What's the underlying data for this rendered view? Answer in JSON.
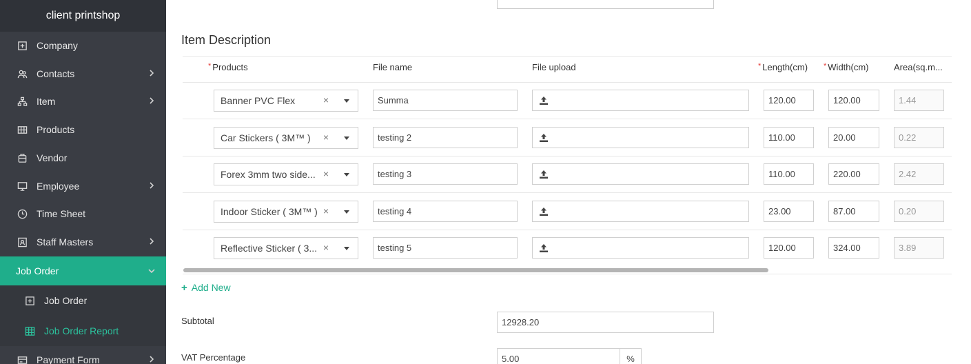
{
  "sidebar": {
    "brand": "client printshop",
    "items": [
      {
        "label": "Company",
        "icon": "plus-square-icon",
        "chevron": false
      },
      {
        "label": "Contacts",
        "icon": "users-icon",
        "chevron": true
      },
      {
        "label": "Item",
        "icon": "sitemap-icon",
        "chevron": true
      },
      {
        "label": "Products",
        "icon": "grid-box-icon",
        "chevron": false
      },
      {
        "label": "Vendor",
        "icon": "briefcase-icon",
        "chevron": false
      },
      {
        "label": "Employee",
        "icon": "monitor-icon",
        "chevron": true
      },
      {
        "label": "Time Sheet",
        "icon": "clock-icon",
        "chevron": false
      },
      {
        "label": "Staff Masters",
        "icon": "id-card-icon",
        "chevron": true
      },
      {
        "label": "Job Order",
        "icon": "",
        "chevron": true,
        "active": true
      },
      {
        "label": "Job Order",
        "icon": "plus-square-icon",
        "sub": true
      },
      {
        "label": "Job Order Report",
        "icon": "table-icon",
        "sub": true,
        "highlight": true
      },
      {
        "label": "Payment Form",
        "icon": "card-icon",
        "chevron": true
      }
    ]
  },
  "main": {
    "section_title": "Item Description",
    "columns": {
      "products": "Products",
      "file_name": "File name",
      "file_upload": "File upload",
      "length": "Length(cm)",
      "width": "Width(cm)",
      "area": "Area(sq.m..."
    },
    "rows": [
      {
        "product": "Banner PVC Flex",
        "file_name": "Summa",
        "length": "120.00",
        "width": "120.00",
        "area": "1.44"
      },
      {
        "product": "Car Stickers ( 3M™ )",
        "file_name": "testing 2",
        "length": "110.00",
        "width": "20.00",
        "area": "0.22"
      },
      {
        "product": "Forex 3mm two side...",
        "file_name": "testing 3",
        "length": "110.00",
        "width": "220.00",
        "area": "2.42"
      },
      {
        "product": "Indoor Sticker ( 3M™ )",
        "file_name": "testing 4",
        "length": "23.00",
        "width": "87.00",
        "area": "0.20"
      },
      {
        "product": "Reflective Sticker ( 3...",
        "file_name": "testing 5",
        "length": "120.00",
        "width": "324.00",
        "area": "3.89"
      }
    ],
    "clear_symbol": "×",
    "add_new": "Add New",
    "subtotal_label": "Subtotal",
    "subtotal_value": "12928.20",
    "vat_label": "VAT Percentage",
    "vat_value": "5.00",
    "vat_unit": "%"
  },
  "colors": {
    "accent": "#1fae8b",
    "sidebar_bg": "#3a3d44",
    "required": "#e53935"
  }
}
